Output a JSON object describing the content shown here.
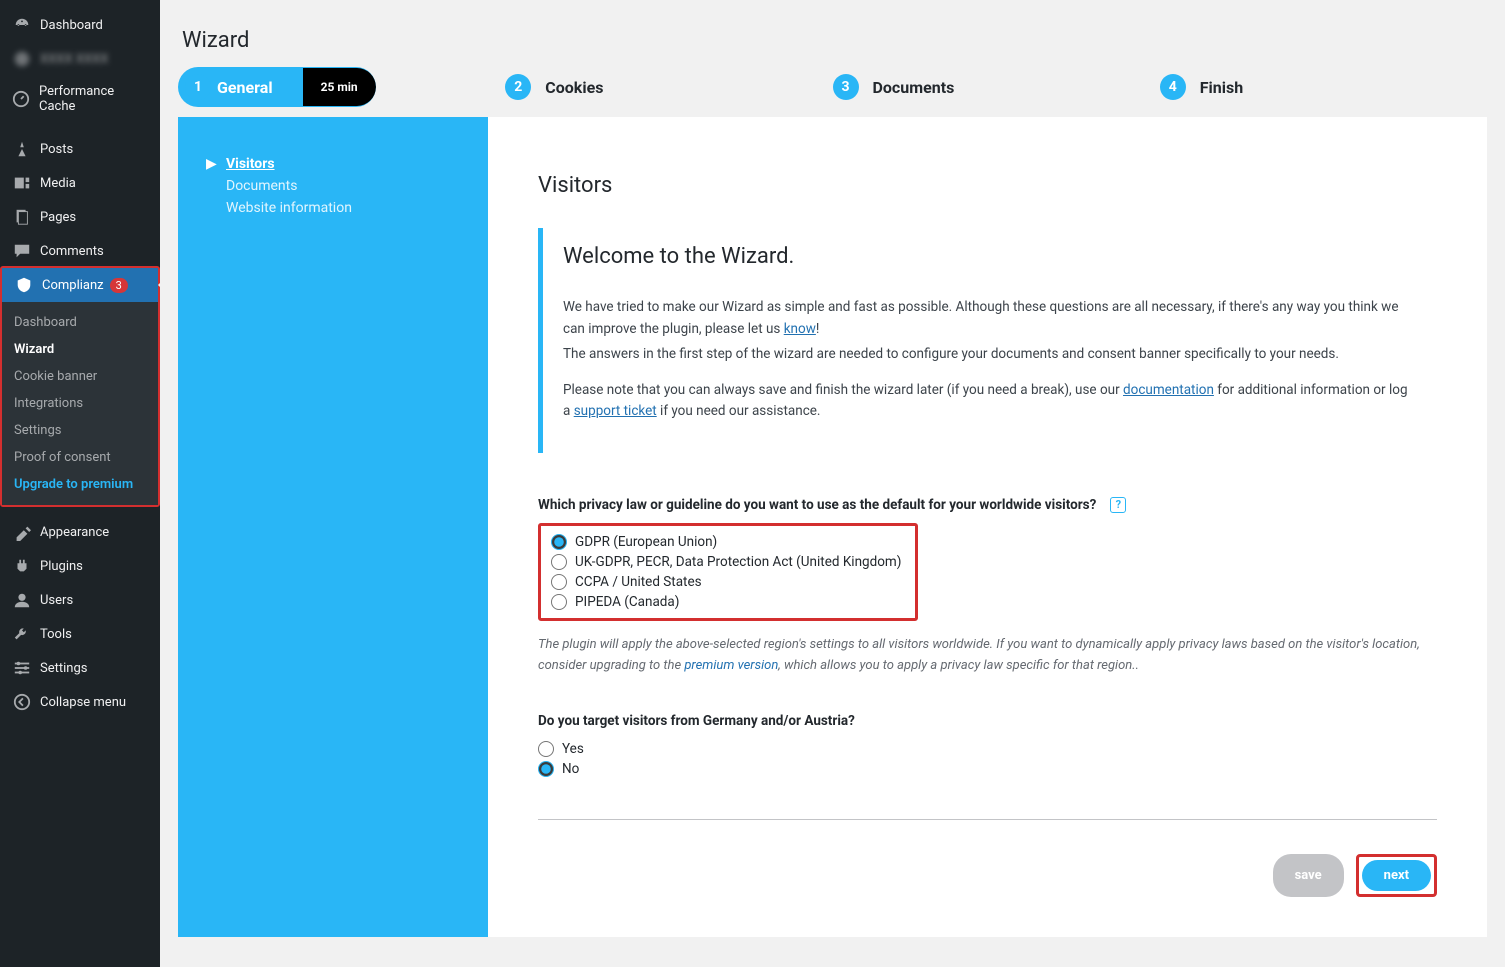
{
  "sidebar": {
    "items": [
      {
        "label": "Dashboard",
        "icon": "gauge"
      },
      {
        "label": "XXXX XXXX",
        "icon": "logo",
        "blurred": true
      },
      {
        "label": "Performance Cache",
        "icon": "gauge"
      },
      {
        "label": "Posts",
        "icon": "pin"
      },
      {
        "label": "Media",
        "icon": "media"
      },
      {
        "label": "Pages",
        "icon": "page"
      },
      {
        "label": "Comments",
        "icon": "comment"
      },
      {
        "label": "Complianz",
        "icon": "shield",
        "badge": "3",
        "active": true
      },
      {
        "label": "Appearance",
        "icon": "brush"
      },
      {
        "label": "Plugins",
        "icon": "plug"
      },
      {
        "label": "Users",
        "icon": "user"
      },
      {
        "label": "Tools",
        "icon": "wrench"
      },
      {
        "label": "Settings",
        "icon": "sliders"
      },
      {
        "label": "Collapse menu",
        "icon": "collapse"
      }
    ],
    "submenu": [
      {
        "label": "Dashboard"
      },
      {
        "label": "Wizard",
        "current": true
      },
      {
        "label": "Cookie banner"
      },
      {
        "label": "Integrations"
      },
      {
        "label": "Settings"
      },
      {
        "label": "Proof of consent"
      },
      {
        "label": "Upgrade to premium",
        "premium": true
      }
    ]
  },
  "page": {
    "title": "Wizard"
  },
  "steps": [
    {
      "num": "1",
      "label": "General",
      "time": "25 min",
      "active": true
    },
    {
      "num": "2",
      "label": "Cookies"
    },
    {
      "num": "3",
      "label": "Documents"
    },
    {
      "num": "4",
      "label": "Finish"
    }
  ],
  "subnav": [
    {
      "label": "Visitors",
      "active": true
    },
    {
      "label": "Documents"
    },
    {
      "label": "Website information"
    }
  ],
  "content": {
    "heading": "Visitors",
    "welcome_title": "Welcome to the Wizard.",
    "p1a": "We have tried to make our Wizard as simple and fast as possible. Although these questions are all necessary, if there's any way you think we can improve the plugin, please let us ",
    "p1_link": "know",
    "p1b": "!",
    "p2": "The answers in the first step of the wizard are needed to configure your documents and consent banner specifically to your needs.",
    "p3a": "Please note that you can always save and finish the wizard later (if you need a break), use our ",
    "p3_link1": "documentation",
    "p3b": " for additional information or log a ",
    "p3_link2": "support ticket",
    "p3c": " if you need our assistance.",
    "q1": "Which privacy law or guideline do you want to use as the default for your worldwide visitors?",
    "q1_options": [
      {
        "label": "GDPR (European Union)",
        "checked": true
      },
      {
        "label": "UK-GDPR, PECR, Data Protection Act (United Kingdom)"
      },
      {
        "label": "CCPA / United States"
      },
      {
        "label": "PIPEDA (Canada)"
      }
    ],
    "q1_hint_a": "The plugin will apply the above-selected region's settings to all visitors worldwide. If you want to dynamically apply privacy laws based on the visitor's location, consider upgrading to the ",
    "q1_hint_link": "premium version",
    "q1_hint_b": ", which allows you to apply a privacy law specific for that region..",
    "q2": "Do you target visitors from Germany and/or Austria?",
    "q2_options": [
      {
        "label": "Yes"
      },
      {
        "label": "No",
        "checked": true
      }
    ],
    "btn_save": "save",
    "btn_next": "next"
  }
}
